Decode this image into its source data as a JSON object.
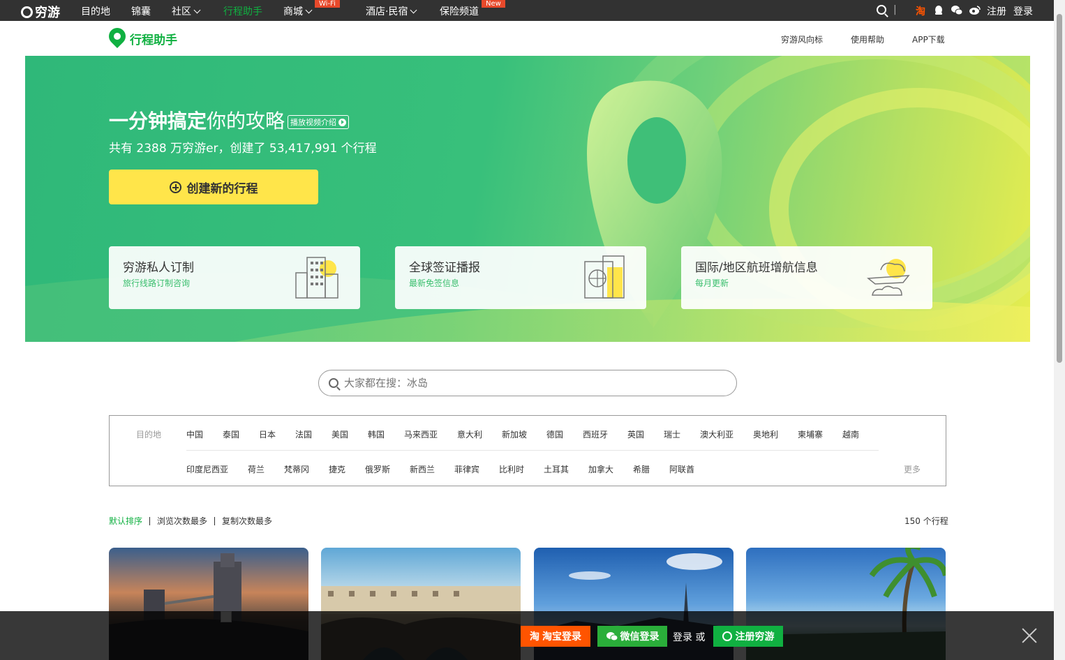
{
  "topnav": {
    "logo": "穷游",
    "items": [
      "目的地",
      "锦囊",
      "社区",
      "行程助手",
      "商城",
      "酒店·民宿",
      "保险频道"
    ],
    "badges": {
      "mall": "Wi-Fi",
      "insurance": "New"
    },
    "right": {
      "divider": "|",
      "taobao": "淘",
      "register": "注册",
      "login": "登录"
    }
  },
  "subnav": {
    "brand": "行程助手",
    "links": [
      "穷游风向标",
      "使用帮助",
      "APP下载"
    ]
  },
  "hero": {
    "title_bold": "一分钟搞定",
    "title_light": "你的攻略",
    "video_label": "播放视频介绍",
    "stat": "共有 2388 万穷游er，创建了 53,417,991 个行程",
    "create_label": "创建新的行程",
    "cards": [
      {
        "title": "穷游私人订制",
        "sub": "旅行线路订制咨询",
        "icon": "building-icon"
      },
      {
        "title": "全球签证播报",
        "sub": "最新免签信息",
        "icon": "passport-icon"
      },
      {
        "title": "国际/地区航班增航信息",
        "sub": "每月更新",
        "icon": "airplane-cloud-icon"
      }
    ]
  },
  "search": {
    "placeholder": "大家都在搜：冰岛"
  },
  "destinations": {
    "label": "目的地",
    "row1": [
      "中国",
      "泰国",
      "日本",
      "法国",
      "美国",
      "韩国",
      "马来西亚",
      "意大利",
      "新加坡",
      "德国",
      "西班牙",
      "英国",
      "瑞士",
      "澳大利亚",
      "奥地利",
      "柬埔寨",
      "越南"
    ],
    "row2": [
      "印度尼西亚",
      "荷兰",
      "梵蒂冈",
      "捷克",
      "俄罗斯",
      "新西兰",
      "菲律宾",
      "比利时",
      "土耳其",
      "加拿大",
      "希腊",
      "阿联酋"
    ],
    "more": "更多"
  },
  "sort": {
    "options": [
      "默认排序",
      "浏览次数最多",
      "复制次数最多"
    ],
    "count": "150 个行程"
  },
  "login_bar": {
    "taobao": "淘宝登录",
    "wechat": "微信登录",
    "login_or": "登录 或",
    "register": "注册穷游"
  },
  "colors": {
    "brand_green": "#10b041",
    "hero_yellow": "#ffe54a",
    "taobao_orange": "#ff5400"
  }
}
